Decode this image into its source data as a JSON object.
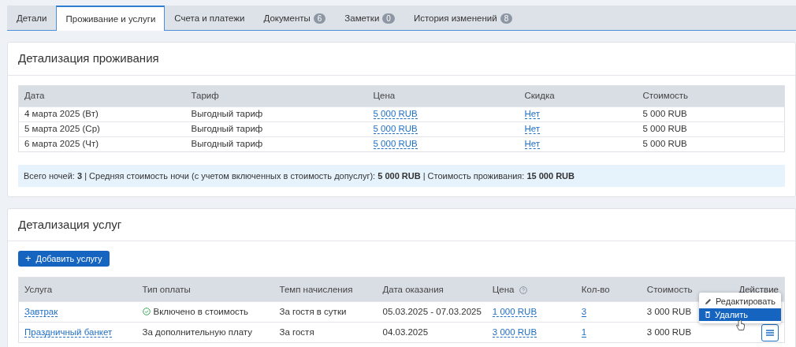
{
  "tabs": [
    {
      "label": "Детали",
      "selected": false
    },
    {
      "label": "Проживание и услуги",
      "selected": true
    },
    {
      "label": "Счета и платежи",
      "selected": false
    },
    {
      "label": "Документы",
      "count": "6",
      "selected": false
    },
    {
      "label": "Заметки",
      "count": "0",
      "selected": false
    },
    {
      "label": "История изменений",
      "count": "8",
      "selected": false
    }
  ],
  "stay": {
    "title": "Детализация проживания",
    "columns": [
      "Дата",
      "Тариф",
      "Цена",
      "Скидка",
      "Стоимость"
    ],
    "rows": [
      {
        "date": "4 марта 2025 (Вт)",
        "rate": "Выгодный тариф",
        "price": "5 000 RUB",
        "discount": "Нет",
        "cost": "5 000 RUB"
      },
      {
        "date": "5 марта 2025 (Ср)",
        "rate": "Выгодный тариф",
        "price": "5 000 RUB",
        "discount": "Нет",
        "cost": "5 000 RUB"
      },
      {
        "date": "6 марта 2025 (Чт)",
        "rate": "Выгодный тариф",
        "price": "5 000 RUB",
        "discount": "Нет",
        "cost": "5 000 RUB"
      }
    ],
    "summary": "Всего ночей: **3** | Средняя стоимость ночи (с учетом включенных в стоимость допуслуг): **5 000 RUB** | Стоимость проживания: **15 000 RUB**"
  },
  "services": {
    "title": "Детализация услуг",
    "add_icon": "+",
    "add_button": "Добавить услугу",
    "columns": [
      "Услуга",
      "Тип оплаты",
      "Темп начисления",
      "Дата оказания",
      "Цена",
      "Кол-во",
      "Стоимость",
      "Действие"
    ],
    "rows": [
      {
        "name": "Завтрак",
        "payment": "Включено в стоимость",
        "included": true,
        "rate": "За гостя в сутки",
        "dates": "05.03.2025 - 07.03.2025",
        "price": "1 000 RUB",
        "qty": "3",
        "cost": "3 000 RUB",
        "menu_button": false
      },
      {
        "name": "Праздничный банкет",
        "payment": "За дополнительную плату",
        "included": false,
        "rate": "За гостя",
        "dates": "04.03.2025",
        "price": "3 000 RUB",
        "qty": "1",
        "cost": "3 000 RUB",
        "menu_button": true
      }
    ],
    "action_menu": [
      {
        "kind": "edit",
        "label": "Редактировать",
        "selected": false
      },
      {
        "kind": "delete",
        "label": "Удалить",
        "selected": true
      }
    ]
  }
}
